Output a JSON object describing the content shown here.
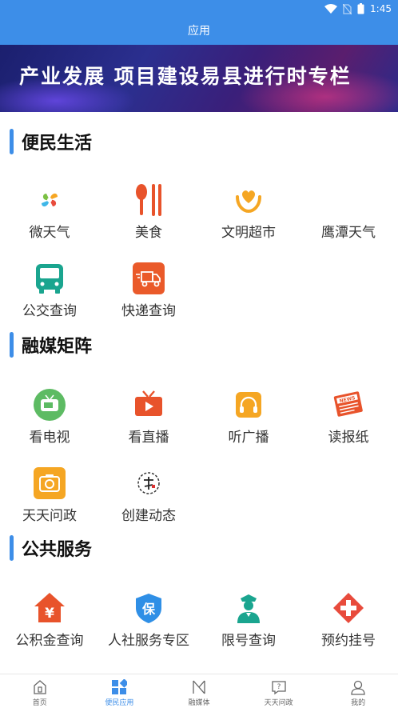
{
  "status_bar": {
    "time": "1:45"
  },
  "header": {
    "title": "应用"
  },
  "banner": {
    "text": "产业发展  项目建设易县进行时专栏",
    "page_count": 2,
    "current_page": 1
  },
  "sections": [
    {
      "title": "便民生活",
      "items": [
        {
          "label": "微天气",
          "icon": "weather-pinwheel-icon"
        },
        {
          "label": "美食",
          "icon": "spoon-fork-icon"
        },
        {
          "label": "文明超市",
          "icon": "heart-hands-icon"
        },
        {
          "label": "鹰潭天气",
          "icon": "blank-icon"
        },
        {
          "label": "公交查询",
          "icon": "bus-icon"
        },
        {
          "label": "快递查询",
          "icon": "delivery-truck-icon"
        }
      ]
    },
    {
      "title": "融媒矩阵",
      "items": [
        {
          "label": "看电视",
          "icon": "tv-icon"
        },
        {
          "label": "看直播",
          "icon": "live-video-icon"
        },
        {
          "label": "听广播",
          "icon": "headphones-icon"
        },
        {
          "label": "读报纸",
          "icon": "newspaper-icon"
        },
        {
          "label": "天天问政",
          "icon": "camera-icon"
        },
        {
          "label": "创建动态",
          "icon": "calligraphy-seal-icon"
        }
      ]
    },
    {
      "title": "公共服务",
      "items": [
        {
          "label": "公积金查询",
          "icon": "yuan-house-icon"
        },
        {
          "label": "人社服务专区",
          "icon": "shield-bao-icon"
        },
        {
          "label": "限号查询",
          "icon": "police-officer-icon"
        },
        {
          "label": "预约挂号",
          "icon": "medical-cross-icon"
        }
      ]
    }
  ],
  "tabs": [
    {
      "label": "首页",
      "icon": "home-icon",
      "active": false
    },
    {
      "label": "便民应用",
      "icon": "apps-grid-icon",
      "active": true
    },
    {
      "label": "融媒体",
      "icon": "media-icon",
      "active": false
    },
    {
      "label": "天天问政",
      "icon": "question-icon",
      "active": false
    },
    {
      "label": "我的",
      "icon": "user-icon",
      "active": false
    }
  ],
  "colors": {
    "accent": "#3d8ee8",
    "text": "#333333"
  }
}
